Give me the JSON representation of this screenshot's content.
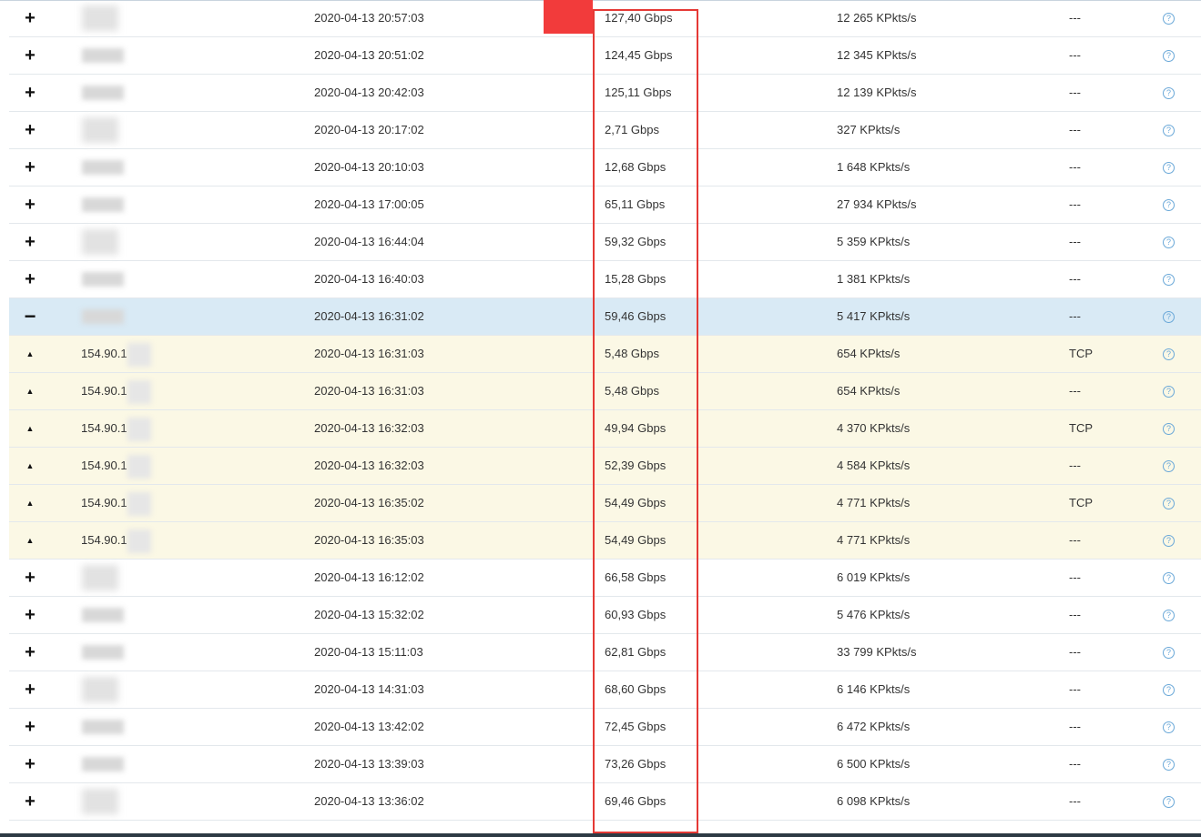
{
  "rows": [
    {
      "toggle": "+",
      "type": "parent",
      "ip": "",
      "date": "2020-04-13 20:57:03",
      "gbps": "127,40 Gbps",
      "pkts": "12 265 KPkts/s",
      "proto": "---"
    },
    {
      "toggle": "+",
      "type": "parent",
      "ip": "",
      "date": "2020-04-13 20:51:02",
      "gbps": "124,45 Gbps",
      "pkts": "12 345 KPkts/s",
      "proto": "---"
    },
    {
      "toggle": "+",
      "type": "parent",
      "ip": "",
      "date": "2020-04-13 20:42:03",
      "gbps": "125,11 Gbps",
      "pkts": "12 139 KPkts/s",
      "proto": "---"
    },
    {
      "toggle": "+",
      "type": "parent",
      "ip": "",
      "date": "2020-04-13 20:17:02",
      "gbps": "2,71 Gbps",
      "pkts": "327 KPkts/s",
      "proto": "---"
    },
    {
      "toggle": "+",
      "type": "parent",
      "ip": "",
      "date": "2020-04-13 20:10:03",
      "gbps": "12,68 Gbps",
      "pkts": "1 648 KPkts/s",
      "proto": "---"
    },
    {
      "toggle": "+",
      "type": "parent",
      "ip": "",
      "date": "2020-04-13 17:00:05",
      "gbps": "65,11 Gbps",
      "pkts": "27 934 KPkts/s",
      "proto": "---"
    },
    {
      "toggle": "+",
      "type": "parent",
      "ip": "",
      "date": "2020-04-13 16:44:04",
      "gbps": "59,32 Gbps",
      "pkts": "5 359 KPkts/s",
      "proto": "---"
    },
    {
      "toggle": "+",
      "type": "parent",
      "ip": "",
      "date": "2020-04-13 16:40:03",
      "gbps": "15,28 Gbps",
      "pkts": "1 381 KPkts/s",
      "proto": "---"
    },
    {
      "toggle": "−",
      "type": "expanded",
      "ip": "",
      "date": "2020-04-13 16:31:02",
      "gbps": "59,46 Gbps",
      "pkts": "5 417 KPkts/s",
      "proto": "---"
    },
    {
      "toggle": "▲",
      "type": "child",
      "ip": "154.90.1",
      "date": "2020-04-13 16:31:03",
      "gbps": "5,48 Gbps",
      "pkts": "654 KPkts/s",
      "proto": "TCP"
    },
    {
      "toggle": "▲",
      "type": "child",
      "ip": "154.90.1",
      "date": "2020-04-13 16:31:03",
      "gbps": "5,48 Gbps",
      "pkts": "654 KPkts/s",
      "proto": "---"
    },
    {
      "toggle": "▲",
      "type": "child",
      "ip": "154.90.1",
      "date": "2020-04-13 16:32:03",
      "gbps": "49,94 Gbps",
      "pkts": "4 370 KPkts/s",
      "proto": "TCP"
    },
    {
      "toggle": "▲",
      "type": "child",
      "ip": "154.90.1",
      "date": "2020-04-13 16:32:03",
      "gbps": "52,39 Gbps",
      "pkts": "4 584 KPkts/s",
      "proto": "---"
    },
    {
      "toggle": "▲",
      "type": "child",
      "ip": "154.90.1",
      "date": "2020-04-13 16:35:02",
      "gbps": "54,49 Gbps",
      "pkts": "4 771 KPkts/s",
      "proto": "TCP"
    },
    {
      "toggle": "▲",
      "type": "child",
      "ip": "154.90.1",
      "date": "2020-04-13 16:35:03",
      "gbps": "54,49 Gbps",
      "pkts": "4 771 KPkts/s",
      "proto": "---"
    },
    {
      "toggle": "+",
      "type": "parent",
      "ip": "",
      "date": "2020-04-13 16:12:02",
      "gbps": "66,58 Gbps",
      "pkts": "6 019 KPkts/s",
      "proto": "---"
    },
    {
      "toggle": "+",
      "type": "parent",
      "ip": "",
      "date": "2020-04-13 15:32:02",
      "gbps": "60,93 Gbps",
      "pkts": "5 476 KPkts/s",
      "proto": "---"
    },
    {
      "toggle": "+",
      "type": "parent",
      "ip": "",
      "date": "2020-04-13 15:11:03",
      "gbps": "62,81 Gbps",
      "pkts": "33 799 KPkts/s",
      "proto": "---"
    },
    {
      "toggle": "+",
      "type": "parent",
      "ip": "",
      "date": "2020-04-13 14:31:03",
      "gbps": "68,60 Gbps",
      "pkts": "6 146 KPkts/s",
      "proto": "---"
    },
    {
      "toggle": "+",
      "type": "parent",
      "ip": "",
      "date": "2020-04-13 13:42:02",
      "gbps": "72,45 Gbps",
      "pkts": "6 472 KPkts/s",
      "proto": "---"
    },
    {
      "toggle": "+",
      "type": "parent",
      "ip": "",
      "date": "2020-04-13 13:39:03",
      "gbps": "73,26 Gbps",
      "pkts": "6 500 KPkts/s",
      "proto": "---"
    },
    {
      "toggle": "+",
      "type": "parent",
      "ip": "",
      "date": "2020-04-13 13:36:02",
      "gbps": "69,46 Gbps",
      "pkts": "6 098 KPkts/s",
      "proto": "---"
    }
  ],
  "help_glyph": "?",
  "colors": {
    "highlight": "#e53935",
    "expanded_row": "#d9eaf5",
    "child_row": "#fbf8e5",
    "help_icon": "#6aa8d8"
  }
}
